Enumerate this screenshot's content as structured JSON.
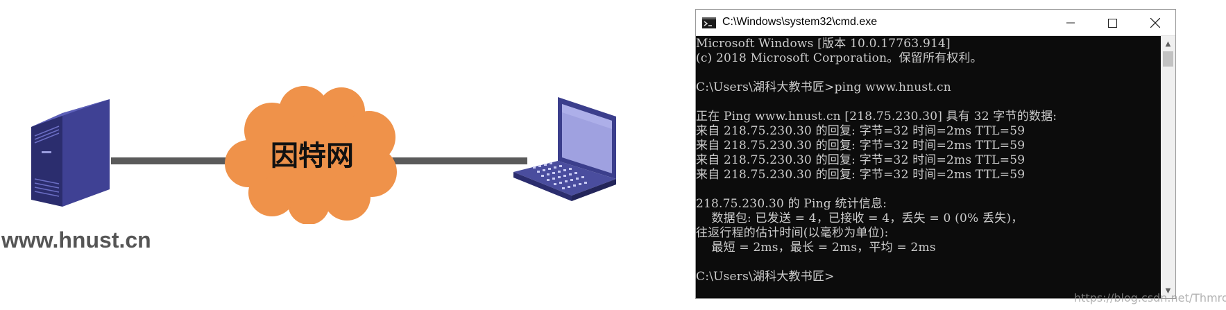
{
  "diagram": {
    "cloud_label": "因特网",
    "server_name": "www.hnust.cn",
    "cloud_color": "#ef924a",
    "server_color": "#2b2d6e",
    "laptop_color": "#3b3e8c",
    "line_color": "#5a5a5a"
  },
  "cmd": {
    "title": "C:\\Windows\\system32\\cmd.exe",
    "minimize_icon": "minimize-icon",
    "maximize_icon": "maximize-icon",
    "close_icon": "close-icon",
    "text_color": "#cccccc",
    "background": "#0c0c0c",
    "lines": [
      "Microsoft Windows [版本 10.0.17763.914]",
      "(c) 2018 Microsoft Corporation。保留所有权利。",
      "",
      "C:\\Users\\湖科大教书匠>ping www.hnust.cn",
      "",
      "正在 Ping www.hnust.cn [218.75.230.30] 具有 32 字节的数据:",
      "来自 218.75.230.30 的回复: 字节=32 时间=2ms TTL=59",
      "来自 218.75.230.30 的回复: 字节=32 时间=2ms TTL=59",
      "来自 218.75.230.30 的回复: 字节=32 时间=2ms TTL=59",
      "来自 218.75.230.30 的回复: 字节=32 时间=2ms TTL=59",
      "",
      "218.75.230.30 的 Ping 统计信息:",
      "    数据包: 已发送 = 4，已接收 = 4，丢失 = 0 (0% 丢失)，",
      "往返行程的估计时间(以毫秒为单位):",
      "    最短 = 2ms，最长 = 2ms，平均 = 2ms",
      "",
      "C:\\Users\\湖科大教书匠>"
    ]
  },
  "watermark": "https://blog.csdn.net/Thmrod__"
}
